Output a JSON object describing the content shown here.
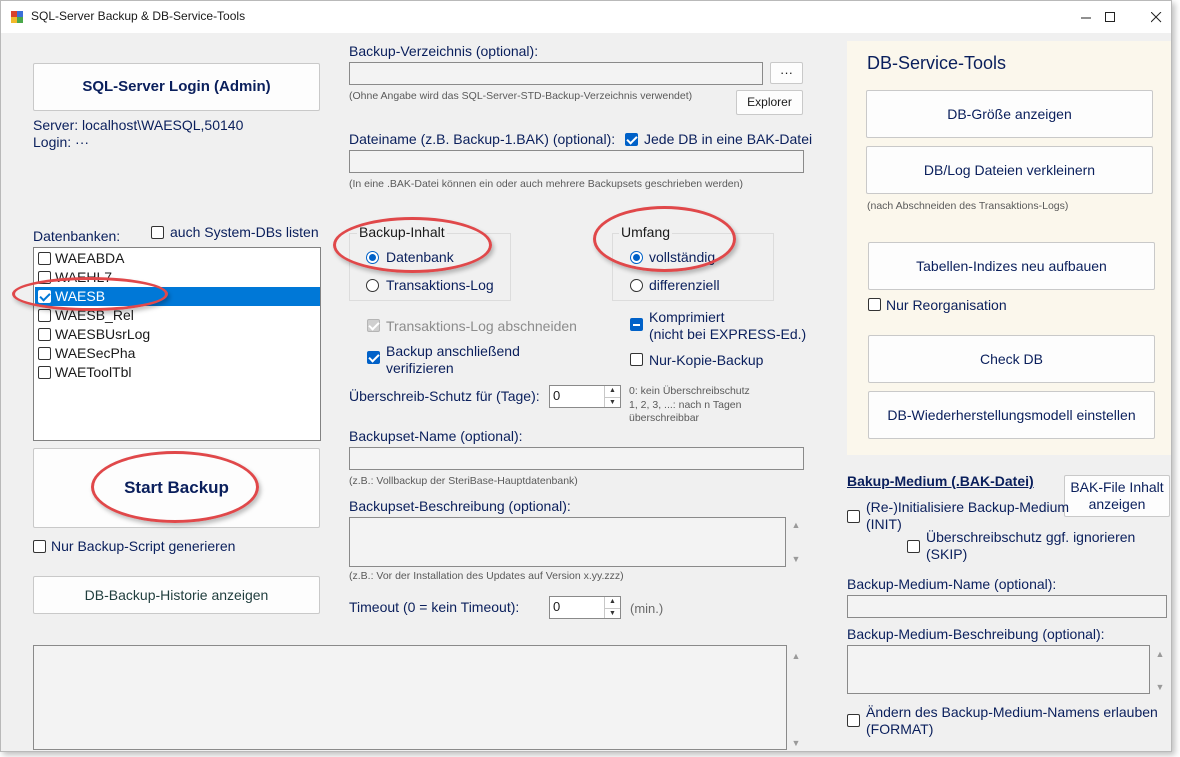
{
  "window": {
    "title": "SQL-Server Backup & DB-Service-Tools"
  },
  "login": {
    "button_label": "SQL-Server Login (Admin)",
    "server_text": "Server: localhost\\WAESQL,50140",
    "login_text": "Login: ···"
  },
  "databases": {
    "label": "Datenbanken:",
    "system_dbs_label": "auch System-DBs listen",
    "items": [
      {
        "name": "WAEABDA",
        "checked": false
      },
      {
        "name": "WAEHL7",
        "checked": false
      },
      {
        "name": "WAESB",
        "checked": true
      },
      {
        "name": "WAESB_Rel",
        "checked": false
      },
      {
        "name": "WAESBUsrLog",
        "checked": false
      },
      {
        "name": "WAESecPha",
        "checked": false
      },
      {
        "name": "WAEToolTbl",
        "checked": false
      }
    ]
  },
  "start": {
    "button_label": "Start Backup",
    "script_only_label": "Nur Backup-Script generieren",
    "history_button_label": "DB-Backup-Historie anzeigen"
  },
  "backup_dir": {
    "label": "Backup-Verzeichnis (optional):",
    "value": "",
    "browse_label": "···",
    "hint": "(Ohne Angabe wird das SQL-Server-STD-Backup-Verzeichnis verwendet)",
    "explorer_label": "Explorer"
  },
  "filename": {
    "label": "Dateiname (z.B. Backup-1.BAK) (optional):",
    "each_db_label": "Jede DB in eine BAK-Datei",
    "value": "",
    "hint": "(In eine .BAK-Datei können ein oder auch mehrere Backupsets geschrieben werden)"
  },
  "content": {
    "group_label": "Backup-Inhalt",
    "database_label": "Datenbank",
    "translog_label": "Transaktions-Log"
  },
  "scope": {
    "group_label": "Umfang",
    "full_label": "vollständig",
    "diff_label": "differenziell"
  },
  "options": {
    "truncate_log_label": "Transaktions-Log abschneiden",
    "verify_label_1": "Backup anschließend",
    "verify_label_2": "verifizieren",
    "compress_label_1": "Komprimiert",
    "compress_label_2": "(nicht bei EXPRESS-Ed.)",
    "copy_only_label": "Nur-Kopie-Backup"
  },
  "overwrite": {
    "label": "Überschreib-Schutz für (Tage):",
    "value": "0",
    "hint_1": "0: kein Überschreibschutz",
    "hint_2": "1, 2, 3, ...: nach n Tagen",
    "hint_3": "überschreibbar"
  },
  "backupset_name": {
    "label": "Backupset-Name (optional):",
    "value": "",
    "hint": "(z.B.:  Vollbackup der SteriBase-Hauptdatenbank)"
  },
  "backupset_desc": {
    "label": "Backupset-Beschreibung (optional):",
    "value": "",
    "hint": "(z.B.:  Vor der Installation des Updates auf Version x.yy.zzz)"
  },
  "timeout": {
    "label": "Timeout (0 = kein Timeout):",
    "value": "0",
    "unit": "(min.)"
  },
  "tools": {
    "title": "DB-Service-Tools",
    "size_button": "DB-Größe anzeigen",
    "shrink_button": "DB/Log Dateien verkleinern",
    "shrink_hint": "(nach Abschneiden des Transaktions-Logs)",
    "rebuild_button": "Tabellen-Indizes neu aufbauen",
    "reorg_label": "Nur Reorganisation",
    "check_button": "Check DB",
    "recovery_button": "DB-Wiederherstellungsmodell einstellen"
  },
  "medium": {
    "title": "Bakup-Medium (.BAK-Datei)",
    "bakfile_button_1": "BAK-File Inhalt",
    "bakfile_button_2": "anzeigen",
    "init_label_1": "(Re-)Initialisiere Backup-Medium",
    "init_label_2": "(INIT)",
    "skip_label_1": "Überschreibschutz ggf. ignorieren",
    "skip_label_2": "(SKIP)",
    "name_label": "Backup-Medium-Name (optional):",
    "name_value": "",
    "desc_label": "Backup-Medium-Beschreibung (optional):",
    "desc_value": "",
    "format_label_1": "Ändern des Backup-Medium-Namens erlauben",
    "format_label_2": "(FORMAT)"
  },
  "log_output": ""
}
